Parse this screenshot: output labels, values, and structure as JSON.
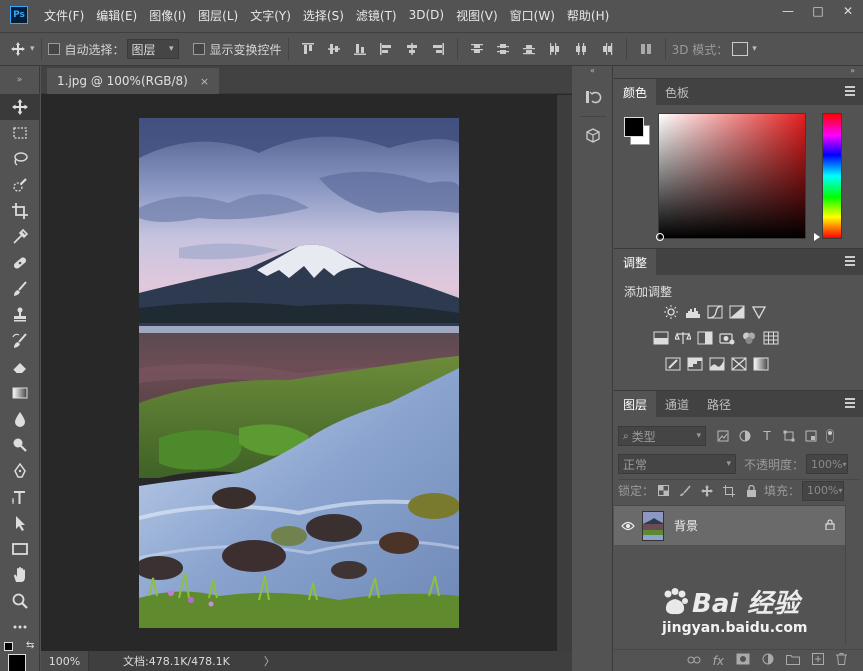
{
  "menubar": {
    "logo": "Ps",
    "items": [
      "文件(F)",
      "编辑(E)",
      "图像(I)",
      "图层(L)",
      "文字(Y)",
      "选择(S)",
      "滤镜(T)",
      "3D(D)",
      "视图(V)",
      "窗口(W)",
      "帮助(H)"
    ],
    "minimize": "—",
    "maximize": "□",
    "close": "✕"
  },
  "options": {
    "auto_select_label": "自动选择：",
    "auto_select_value": "图层",
    "show_transform_label": "显示变换控件",
    "mode_3d_label": "3D 模式："
  },
  "document": {
    "tab_title": "1.jpg @ 100%(RGB/8)",
    "tab_close": "×",
    "zoom": "100%",
    "doc_info": "文档:478.1K/478.1K",
    "status_arrow": "〉"
  },
  "color_panel": {
    "tabs": [
      "颜色",
      "色板"
    ],
    "active_tab": 0,
    "foreground": "#000000",
    "background": "#ffffff",
    "hue_color": "#e41e1e"
  },
  "adjust_panel": {
    "tabs": [
      "调整"
    ],
    "title": "添加调整"
  },
  "layers_panel": {
    "tabs": [
      "图层",
      "通道",
      "路径"
    ],
    "filter_kind": "类型",
    "blend_mode": "正常",
    "opacity_label": "不透明度：",
    "opacity_value": "100%",
    "lock_label": "锁定：",
    "fill_label": "填充：",
    "fill_value": "100%",
    "layers": [
      {
        "name": "背景",
        "visible": true,
        "locked": true
      }
    ],
    "bottom_fx": "fx"
  },
  "watermark": {
    "brand": "Bai 经验",
    "url": "jingyan.baidu.com"
  }
}
